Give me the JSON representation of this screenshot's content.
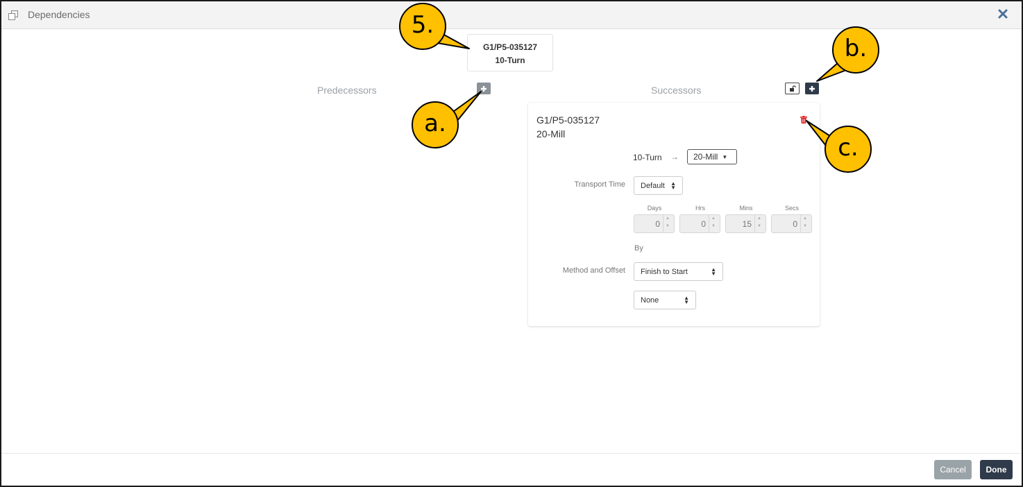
{
  "window": {
    "title": "Dependencies",
    "icon": "copy-icon",
    "close_icon": "close-icon"
  },
  "node": {
    "line1": "G1/P5-035127",
    "line2": "10-Turn"
  },
  "predecessors": {
    "heading": "Predecessors",
    "add_icon": "plus-icon"
  },
  "successors": {
    "heading": "Successors",
    "lock_icon": "unlock-icon",
    "add_icon": "plus-icon",
    "card": {
      "name_line1": "G1/P5-035127",
      "name_line2": "20-Mill",
      "delete_icon": "trash-icon",
      "flow_from": "10-Turn",
      "flow_arrow": "→",
      "flow_to": "20-Mill",
      "transport_time_label": "Transport Time",
      "transport_time_value": "Default",
      "duration": [
        {
          "unit": "Days",
          "value": "0"
        },
        {
          "unit": "Hrs",
          "value": "0"
        },
        {
          "unit": "Mins",
          "value": "15"
        },
        {
          "unit": "Secs",
          "value": "0"
        }
      ],
      "by_label": "By",
      "method_label": "Method and Offset",
      "method_value": "Finish to Start",
      "offset_value": "None"
    }
  },
  "footer": {
    "cancel_label": "Cancel",
    "done_label": "Done"
  },
  "annotations": [
    {
      "label": "5."
    },
    {
      "label": "a."
    },
    {
      "label": "b."
    },
    {
      "label": "c."
    }
  ],
  "colors": {
    "accent_dark": "#2f3b4a",
    "callout_fill": "#ffc000",
    "trash_red": "#e02020",
    "cancel_gray": "#9aa3a8"
  }
}
